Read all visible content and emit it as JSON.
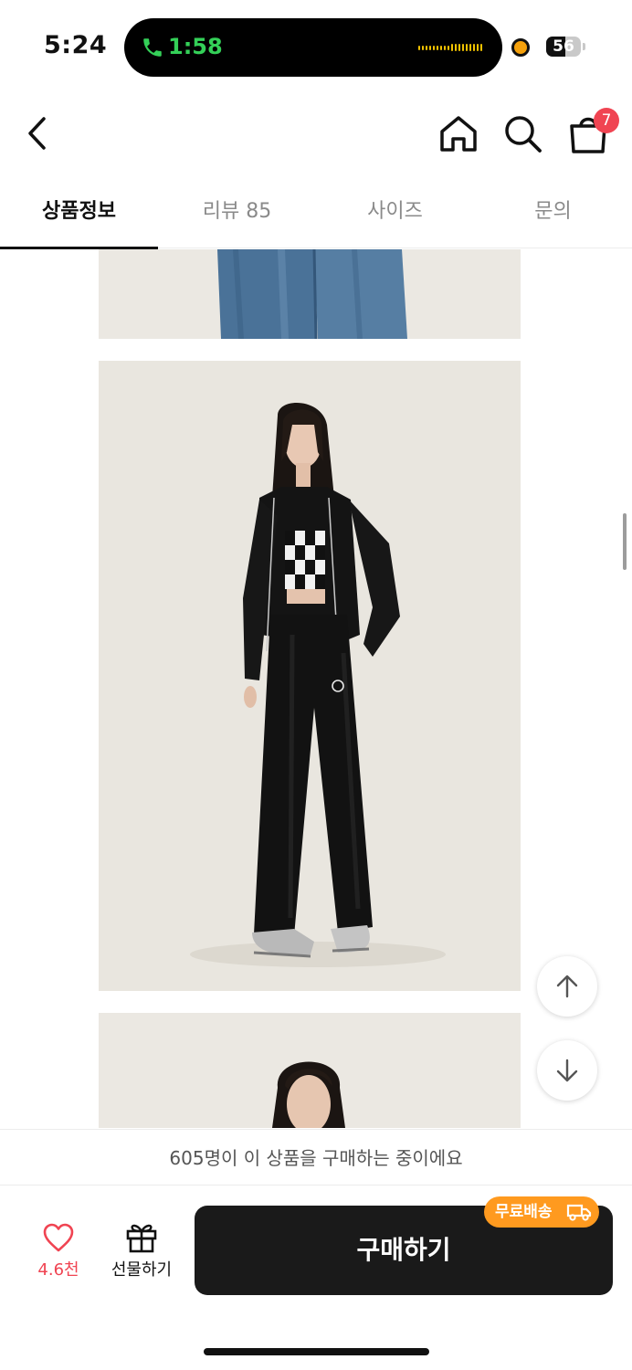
{
  "status_bar": {
    "time": "5:24",
    "call_timer": "1:58",
    "battery_level": "56",
    "battery_fraction": 0.56
  },
  "header": {
    "back_icon": "chevron-left-icon",
    "home_icon": "home-icon",
    "search_icon": "search-icon",
    "cart_icon": "shopping-bag-icon",
    "cart_count": "7"
  },
  "tabs": [
    {
      "label": "상품정보",
      "active": true
    },
    {
      "label": "리뷰 85",
      "active": false
    },
    {
      "label": "사이즈",
      "active": false
    },
    {
      "label": "문의",
      "active": false
    }
  ],
  "floating_buttons": {
    "scroll_up_icon": "arrow-up-icon",
    "scroll_down_icon": "arrow-down-icon"
  },
  "social_proof": {
    "text": "605명이 이 상품을 구매하는 중이에요"
  },
  "bottom_bar": {
    "like_count": "4.6천",
    "gift_label": "선물하기",
    "buy_label": "구매하기",
    "free_shipping_badge": "무료배송"
  },
  "colors": {
    "accent_red": "#f04452",
    "badge_orange": "#ff9a1f",
    "buy_button": "#1a1a1a",
    "call_green": "#34d058"
  }
}
